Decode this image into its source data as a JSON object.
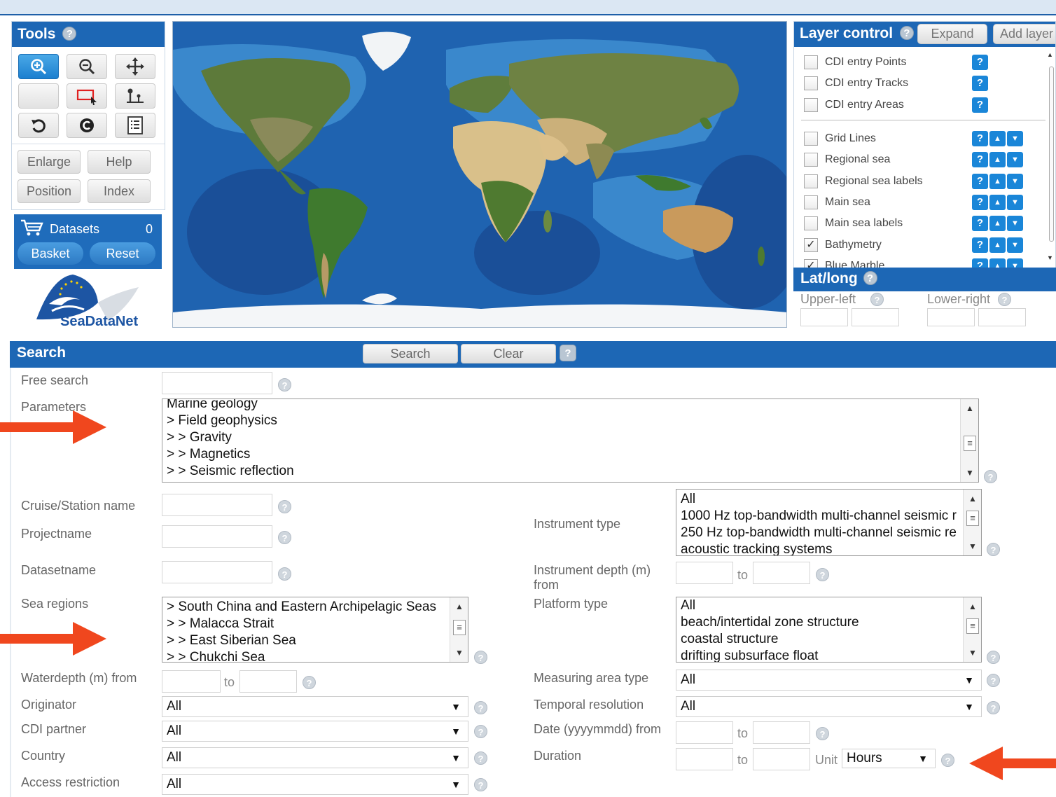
{
  "tools": {
    "title": "Tools",
    "buttons": [
      "Enlarge",
      "Help",
      "Position",
      "Index"
    ]
  },
  "datasets": {
    "label": "Datasets",
    "count": "0",
    "basket": "Basket",
    "reset": "Reset"
  },
  "logo": {
    "text": "SeaDataNet"
  },
  "layer_control": {
    "title": "Layer control",
    "expand": "Expand",
    "add_layer": "Add layer",
    "group1": [
      {
        "label": "CDI entry Points",
        "checked": false
      },
      {
        "label": "CDI entry Tracks",
        "checked": false
      },
      {
        "label": "CDI entry Areas",
        "checked": false
      }
    ],
    "group2": [
      {
        "label": "Grid Lines",
        "checked": false
      },
      {
        "label": "Regional sea",
        "checked": false
      },
      {
        "label": "Regional sea labels",
        "checked": false
      },
      {
        "label": "Main sea",
        "checked": false
      },
      {
        "label": "Main sea labels",
        "checked": false
      },
      {
        "label": "Bathymetry",
        "checked": true
      },
      {
        "label": "Blue Marble",
        "checked": true
      }
    ]
  },
  "latlong": {
    "title": "Lat/long",
    "upper_left": "Upper-left",
    "lower_right": "Lower-right"
  },
  "search": {
    "title": "Search",
    "search_btn": "Search",
    "clear_btn": "Clear",
    "free_search_label": "Free search",
    "parameters_label": "Parameters",
    "parameters_items": [
      "Marine geology",
      "> Field geophysics",
      "> > Gravity",
      "> > Magnetics",
      "> > Seismic reflection"
    ],
    "cruise_label": "Cruise/Station name",
    "project_label": "Projectname",
    "dataset_label": "Datasetname",
    "sea_regions_label": "Sea regions",
    "sea_regions_items": [
      "> South China and Eastern Archipelagic Seas",
      "> > Malacca Strait",
      "> > East Siberian Sea",
      "> > Chukchi Sea"
    ],
    "waterdepth_label": "Waterdepth (m) from",
    "to": "to",
    "originator_label": "Originator",
    "originator_value": "All",
    "cdi_partner_label": "CDI partner",
    "cdi_partner_value": "All",
    "country_label": "Country",
    "country_value": "All",
    "access_label": "Access restriction",
    "access_value": "All",
    "instrument_type_label": "Instrument type",
    "instrument_items": [
      "All",
      "1000 Hz top-bandwidth multi-channel seismic r",
      "250 Hz top-bandwidth multi-channel seismic re",
      "acoustic tracking systems"
    ],
    "instrument_depth_label_1": "Instrument depth (m)",
    "instrument_depth_label_2": "from",
    "platform_label": "Platform type",
    "platform_items": [
      "All",
      "beach/intertidal zone structure",
      "coastal structure",
      "drifting subsurface float"
    ],
    "measuring_label": "Measuring area type",
    "measuring_value": "All",
    "temporal_label": "Temporal resolution",
    "temporal_value": "All",
    "date_label": "Date (yyyymmdd) from",
    "duration_label": "Duration",
    "unit_label": "Unit",
    "unit_value": "Hours"
  },
  "colors": {
    "header_blue": "#1d67b5",
    "annotation_arrow": "#f0471e"
  }
}
